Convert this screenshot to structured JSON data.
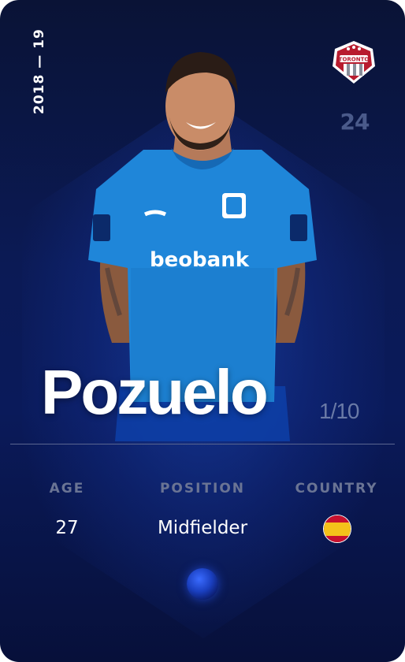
{
  "card": {
    "season": "2018 — 19",
    "shirt_number": "24",
    "player_name": "Pozuelo",
    "serial": "1/10",
    "club_crest_icon": "toronto-fc-crest-icon",
    "rarity_gem_icon": "blue-gem-icon"
  },
  "stats": {
    "age_label": "AGE",
    "age_value": "27",
    "position_label": "POSITION",
    "position_value": "Midfielder",
    "country_label": "COUNTRY",
    "country_flag_icon": "spain-flag-icon"
  },
  "player_image": {
    "shirt_text": "beobank"
  },
  "colors": {
    "background": "#0b1a55",
    "shirt_blue": "#1f86d9",
    "label_gray": "#6a7494"
  }
}
